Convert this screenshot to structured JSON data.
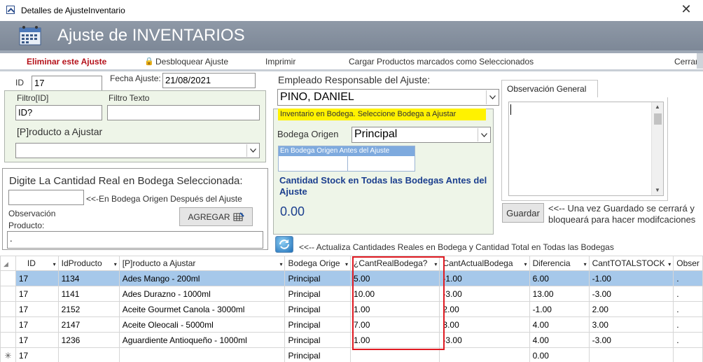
{
  "window": {
    "title": "Detalles de AjusteInventario",
    "close_glyph": "✕"
  },
  "header": {
    "title": "Ajuste de INVENTARIOS",
    "icon": "calendar-grid-icon"
  },
  "menu": {
    "delete": "Eliminar este Ajuste",
    "unlock": "Desbloquear Ajuste",
    "print": "Imprimir",
    "load": "Cargar Productos marcados como Seleccionados",
    "close": "Cerrar"
  },
  "form": {
    "id_label": "ID",
    "id_value": "17",
    "date_label": "Fecha Ajuste:",
    "date_value": "21/08/2021",
    "filter_id_label": "Filtro[ID]",
    "filter_id_value": "ID?",
    "filter_text_label": "Filtro Texto",
    "filter_text_value": "",
    "product_label": "[P]roducto a Ajustar",
    "product_value": "",
    "employee_label": "Empleado Responsable del Ajuste:",
    "employee_value": "PINO, DANIEL",
    "warehouse_notice": "Inventario en Bodega. Seleccione Bodega a Ajustar",
    "origin_label": "Bodega Origen",
    "origin_value": "Principal",
    "before_adjust_label": "En Bodega Origen Antes del Ajuste",
    "stock_all_label": "Cantidad Stock en Todas las Bodegas Antes del Ajuste",
    "stock_all_value": "0.00",
    "real_qty_label": "Digite La Cantidad Real en Bodega Seleccionada:",
    "real_qty_value": "",
    "after_label": "<<-En Bodega Origen Después del Ajuste",
    "obs_product_label": "Observación Producto:",
    "obs_product_value": ".",
    "add_button": "AGREGAR",
    "refresh_note": "<<-- Actualiza Cantidades Reales en Bodega y Cantidad Total en Todas las Bodegas"
  },
  "observation": {
    "tab": "Observación General",
    "value": "",
    "save_button": "Guardar",
    "save_note": "<<-- Una vez Guardado se cerrará y bloqueará para hacer modifcaciones"
  },
  "grid": {
    "columns": [
      "ID",
      "IdProducto",
      "[P]roducto a Ajustar",
      "Bodega Orige",
      "¿CantRealBodega?",
      "CantActualBodega",
      "Diferencia",
      "CantTOTALSTOCK",
      "Obser"
    ],
    "rows": [
      {
        "id": "17",
        "idp": "1134",
        "prod": "Ades Mango - 200ml",
        "bod": "Principal",
        "real": "5.00",
        "actual": "-1.00",
        "dif": "6.00",
        "total": "-1.00",
        "obs": "."
      },
      {
        "id": "17",
        "idp": "1141",
        "prod": "Ades Durazno - 1000ml",
        "bod": "Principal",
        "real": "10.00",
        "actual": "-3.00",
        "dif": "13.00",
        "total": "-3.00",
        "obs": "."
      },
      {
        "id": "17",
        "idp": "2152",
        "prod": "Aceite Gourmet Canola - 3000ml",
        "bod": "Principal",
        "real": "1.00",
        "actual": "2.00",
        "dif": "-1.00",
        "total": "2.00",
        "obs": "."
      },
      {
        "id": "17",
        "idp": "2147",
        "prod": "Aceite Oleocali - 5000ml",
        "bod": "Principal",
        "real": "7.00",
        "actual": "3.00",
        "dif": "4.00",
        "total": "3.00",
        "obs": "."
      },
      {
        "id": "17",
        "idp": "1236",
        "prod": "Aguardiente Antioqueño - 1000ml",
        "bod": "Principal",
        "real": "1.00",
        "actual": "-3.00",
        "dif": "4.00",
        "total": "-3.00",
        "obs": "."
      }
    ],
    "new_row": {
      "marker": "✳",
      "id": "17",
      "bod": "Principal",
      "dif": "0.00"
    }
  }
}
